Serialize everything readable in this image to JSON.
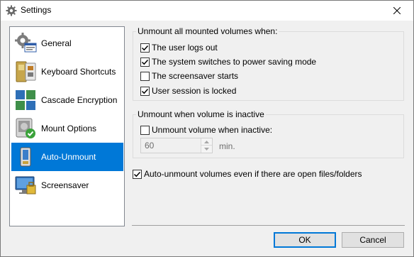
{
  "window": {
    "title": "Settings"
  },
  "sidebar": {
    "items": [
      {
        "label": "General"
      },
      {
        "label": "Keyboard Shortcuts"
      },
      {
        "label": "Cascade Encryption"
      },
      {
        "label": "Mount Options"
      },
      {
        "label": "Auto-Unmount",
        "selected": true
      },
      {
        "label": "Screensaver"
      }
    ]
  },
  "unmount_when": {
    "legend": "Unmount all mounted volumes when:",
    "options": [
      {
        "label": "The user logs out",
        "checked": true
      },
      {
        "label": "The system switches to power saving mode",
        "checked": true
      },
      {
        "label": "The screensaver starts",
        "checked": false
      },
      {
        "label": "User session is locked",
        "checked": true
      }
    ]
  },
  "inactive": {
    "legend": "Unmount when volume is inactive",
    "checkbox_label": "Unmount volume when inactive:",
    "checked": false,
    "value": "60",
    "unit": "min."
  },
  "open_files": {
    "label": "Auto-unmount volumes even if there are open files/folders",
    "checked": true
  },
  "buttons": {
    "ok": "OK",
    "cancel": "Cancel"
  },
  "colors": {
    "selection": "#0078d7",
    "window_bg": "#f0f0f0"
  }
}
